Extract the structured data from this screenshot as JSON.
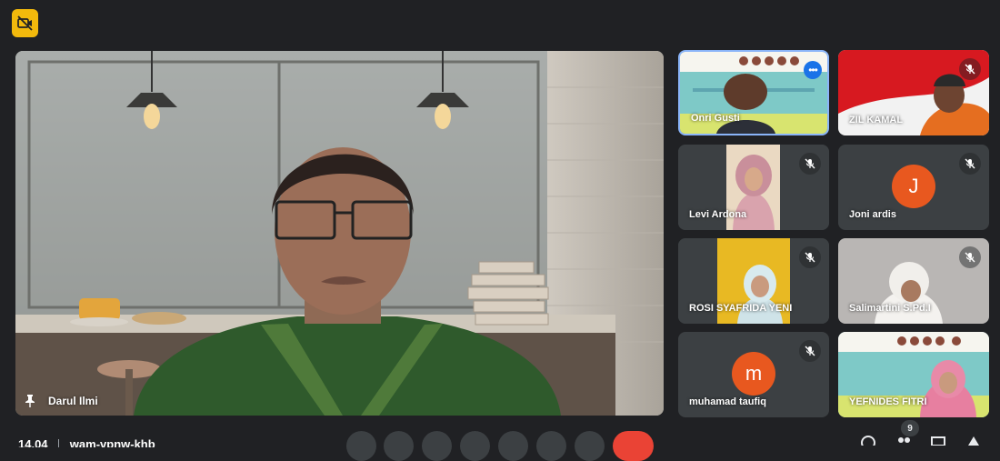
{
  "main": {
    "speaker_name": "Darul Ilmi"
  },
  "tiles": [
    {
      "name": "Onri Gusti",
      "muted": false,
      "more": "•••"
    },
    {
      "name": "ZIL KAMAL",
      "muted": true
    },
    {
      "name": "Levi Ardona",
      "muted": true
    },
    {
      "name": "Joni ardis",
      "muted": true,
      "initial": "J",
      "avatar_color": "#e8581f"
    },
    {
      "name": "ROSI SYAFRIDA YENI",
      "muted": true
    },
    {
      "name": "Salimartini S.Pd.I",
      "muted": true
    },
    {
      "name": "muhamad taufiq",
      "muted": true,
      "initial": "m",
      "avatar_color": "#e8581f"
    },
    {
      "name": "YEFNIDES FITRI",
      "muted": false
    }
  ],
  "footer": {
    "time": "14.04",
    "meeting_code": "wam-vpnw-khb"
  },
  "participants_count": "9",
  "colors": {
    "background": "#202124",
    "accent": "#1a73e8",
    "badge": "#f2b90c",
    "end_call": "#ea4335"
  }
}
